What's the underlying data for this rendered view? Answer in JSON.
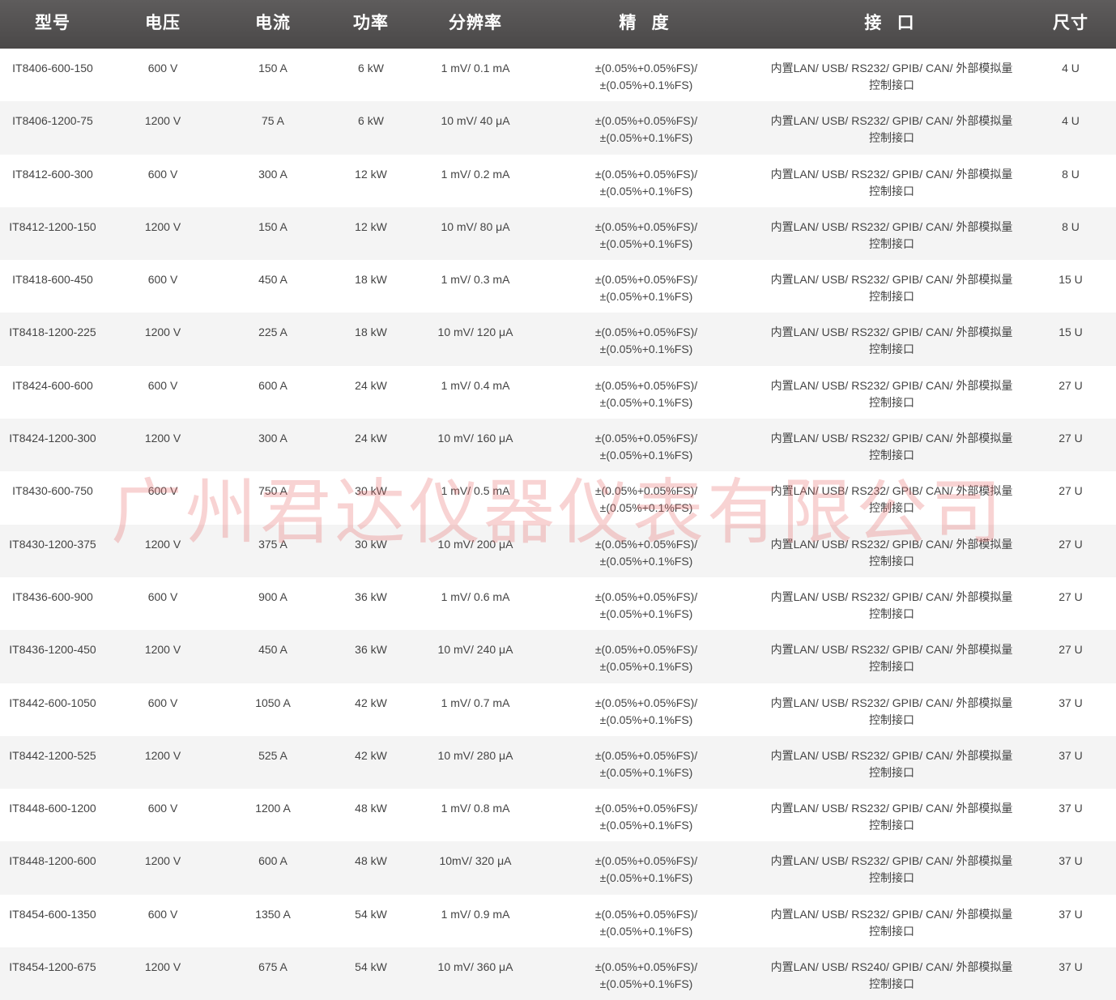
{
  "columns": [
    "型号",
    "电压",
    "电流",
    "功率",
    "分辨率",
    "精 度",
    "接 口",
    "尺寸"
  ],
  "rows": [
    {
      "model": "IT8406-600-150",
      "voltage": "600 V",
      "current": "150 A",
      "power": "6 kW",
      "resolution": "1 mV/ 0.1 mA",
      "accuracy_1": "±(0.05%+0.05%FS)/",
      "accuracy_2": "±(0.05%+0.1%FS)",
      "interface_1": "内置LAN/ USB/ RS232/ GPIB/ CAN/ 外部模拟量",
      "interface_2": "控制接口",
      "size": "4 U"
    },
    {
      "model": "IT8406-1200-75",
      "voltage": "1200 V",
      "current": "75 A",
      "power": "6 kW",
      "resolution": "10 mV/ 40 μA",
      "accuracy_1": "±(0.05%+0.05%FS)/",
      "accuracy_2": "±(0.05%+0.1%FS)",
      "interface_1": "内置LAN/ USB/ RS232/ GPIB/ CAN/ 外部模拟量",
      "interface_2": "控制接口",
      "size": "4 U"
    },
    {
      "model": "IT8412-600-300",
      "voltage": "600 V",
      "current": "300 A",
      "power": "12 kW",
      "resolution": "1 mV/ 0.2 mA",
      "accuracy_1": "±(0.05%+0.05%FS)/",
      "accuracy_2": "±(0.05%+0.1%FS)",
      "interface_1": "内置LAN/ USB/ RS232/ GPIB/ CAN/ 外部模拟量",
      "interface_2": "控制接口",
      "size": "8 U"
    },
    {
      "model": "IT8412-1200-150",
      "voltage": "1200 V",
      "current": "150 A",
      "power": "12 kW",
      "resolution": "10 mV/ 80 μA",
      "accuracy_1": "±(0.05%+0.05%FS)/",
      "accuracy_2": "±(0.05%+0.1%FS)",
      "interface_1": "内置LAN/ USB/ RS232/ GPIB/ CAN/ 外部模拟量",
      "interface_2": "控制接口",
      "size": "8 U"
    },
    {
      "model": "IT8418-600-450",
      "voltage": "600 V",
      "current": "450 A",
      "power": "18 kW",
      "resolution": "1 mV/ 0.3 mA",
      "accuracy_1": "±(0.05%+0.05%FS)/",
      "accuracy_2": "±(0.05%+0.1%FS)",
      "interface_1": "内置LAN/ USB/ RS232/ GPIB/ CAN/ 外部模拟量",
      "interface_2": "控制接口",
      "size": "15 U"
    },
    {
      "model": "IT8418-1200-225",
      "voltage": "1200 V",
      "current": "225 A",
      "power": "18 kW",
      "resolution": "10 mV/ 120 μA",
      "accuracy_1": "±(0.05%+0.05%FS)/",
      "accuracy_2": "±(0.05%+0.1%FS)",
      "interface_1": "内置LAN/ USB/ RS232/ GPIB/ CAN/ 外部模拟量",
      "interface_2": "控制接口",
      "size": "15 U"
    },
    {
      "model": "IT8424-600-600",
      "voltage": "600 V",
      "current": "600 A",
      "power": "24 kW",
      "resolution": "1 mV/ 0.4 mA",
      "accuracy_1": "±(0.05%+0.05%FS)/",
      "accuracy_2": "±(0.05%+0.1%FS)",
      "interface_1": "内置LAN/ USB/ RS232/ GPIB/ CAN/ 外部模拟量",
      "interface_2": "控制接口",
      "size": "27 U"
    },
    {
      "model": "IT8424-1200-300",
      "voltage": "1200 V",
      "current": "300 A",
      "power": "24 kW",
      "resolution": "10 mV/ 160 μA",
      "accuracy_1": "±(0.05%+0.05%FS)/",
      "accuracy_2": "±(0.05%+0.1%FS)",
      "interface_1": "内置LAN/ USB/ RS232/ GPIB/ CAN/ 外部模拟量",
      "interface_2": "控制接口",
      "size": "27 U"
    },
    {
      "model": "IT8430-600-750",
      "voltage": "600 V",
      "current": "750 A",
      "power": "30 kW",
      "resolution": "1 mV/ 0.5 mA",
      "accuracy_1": "±(0.05%+0.05%FS)/",
      "accuracy_2": "±(0.05%+0.1%FS)",
      "interface_1": "内置LAN/ USB/ RS232/ GPIB/ CAN/ 外部模拟量",
      "interface_2": "控制接口",
      "size": "27 U"
    },
    {
      "model": "IT8430-1200-375",
      "voltage": "1200 V",
      "current": "375 A",
      "power": "30 kW",
      "resolution": "10 mV/ 200 μA",
      "accuracy_1": "±(0.05%+0.05%FS)/",
      "accuracy_2": "±(0.05%+0.1%FS)",
      "interface_1": "内置LAN/ USB/ RS232/ GPIB/ CAN/ 外部模拟量",
      "interface_2": "控制接口",
      "size": "27 U"
    },
    {
      "model": "IT8436-600-900",
      "voltage": "600 V",
      "current": "900 A",
      "power": "36 kW",
      "resolution": "1 mV/ 0.6 mA",
      "accuracy_1": "±(0.05%+0.05%FS)/",
      "accuracy_2": "±(0.05%+0.1%FS)",
      "interface_1": "内置LAN/ USB/ RS232/ GPIB/ CAN/ 外部模拟量",
      "interface_2": "控制接口",
      "size": "27 U"
    },
    {
      "model": "IT8436-1200-450",
      "voltage": "1200 V",
      "current": "450 A",
      "power": "36 kW",
      "resolution": "10 mV/ 240 μA",
      "accuracy_1": "±(0.05%+0.05%FS)/",
      "accuracy_2": "±(0.05%+0.1%FS)",
      "interface_1": "内置LAN/ USB/ RS232/ GPIB/ CAN/ 外部模拟量",
      "interface_2": "控制接口",
      "size": "27 U"
    },
    {
      "model": "IT8442-600-1050",
      "voltage": "600 V",
      "current": "1050 A",
      "power": "42 kW",
      "resolution": "1 mV/ 0.7 mA",
      "accuracy_1": "±(0.05%+0.05%FS)/",
      "accuracy_2": "±(0.05%+0.1%FS)",
      "interface_1": "内置LAN/ USB/ RS232/ GPIB/ CAN/ 外部模拟量",
      "interface_2": "控制接口",
      "size": "37 U"
    },
    {
      "model": "IT8442-1200-525",
      "voltage": "1200 V",
      "current": "525 A",
      "power": "42 kW",
      "resolution": "10 mV/ 280 μA",
      "accuracy_1": "±(0.05%+0.05%FS)/",
      "accuracy_2": "±(0.05%+0.1%FS)",
      "interface_1": "内置LAN/ USB/ RS232/ GPIB/ CAN/ 外部模拟量",
      "interface_2": "控制接口",
      "size": "37 U"
    },
    {
      "model": "IT8448-600-1200",
      "voltage": "600 V",
      "current": "1200 A",
      "power": "48 kW",
      "resolution": "1 mV/ 0.8 mA",
      "accuracy_1": "±(0.05%+0.05%FS)/",
      "accuracy_2": "±(0.05%+0.1%FS)",
      "interface_1": "内置LAN/ USB/ RS232/ GPIB/ CAN/ 外部模拟量",
      "interface_2": "控制接口",
      "size": "37 U"
    },
    {
      "model": "IT8448-1200-600",
      "voltage": "1200 V",
      "current": "600 A",
      "power": "48 kW",
      "resolution": "10mV/ 320 μA",
      "accuracy_1": "±(0.05%+0.05%FS)/",
      "accuracy_2": "±(0.05%+0.1%FS)",
      "interface_1": "内置LAN/ USB/ RS232/ GPIB/ CAN/ 外部模拟量",
      "interface_2": "控制接口",
      "size": "37 U"
    },
    {
      "model": "IT8454-600-1350",
      "voltage": "600 V",
      "current": "1350 A",
      "power": "54 kW",
      "resolution": "1 mV/ 0.9 mA",
      "accuracy_1": "±(0.05%+0.05%FS)/",
      "accuracy_2": "±(0.05%+0.1%FS)",
      "interface_1": "内置LAN/ USB/ RS232/ GPIB/ CAN/ 外部模拟量",
      "interface_2": "控制接口",
      "size": "37 U"
    },
    {
      "model": "IT8454-1200-675",
      "voltage": "1200 V",
      "current": "675 A",
      "power": "54 kW",
      "resolution": "10 mV/ 360 μA",
      "accuracy_1": "±(0.05%+0.05%FS)/",
      "accuracy_2": "±(0.05%+0.1%FS)",
      "interface_1": "内置LAN/ USB/ RS240/ GPIB/ CAN/ 外部模拟量",
      "interface_2": "控制接口",
      "size": "37 U"
    }
  ],
  "watermark": "广州君达仪器仪表有限公司",
  "colors": {
    "header_bg": "#555353",
    "header_text": "#ffffff",
    "row_alt": "#f4f4f4",
    "watermark": "#e86e6e"
  }
}
